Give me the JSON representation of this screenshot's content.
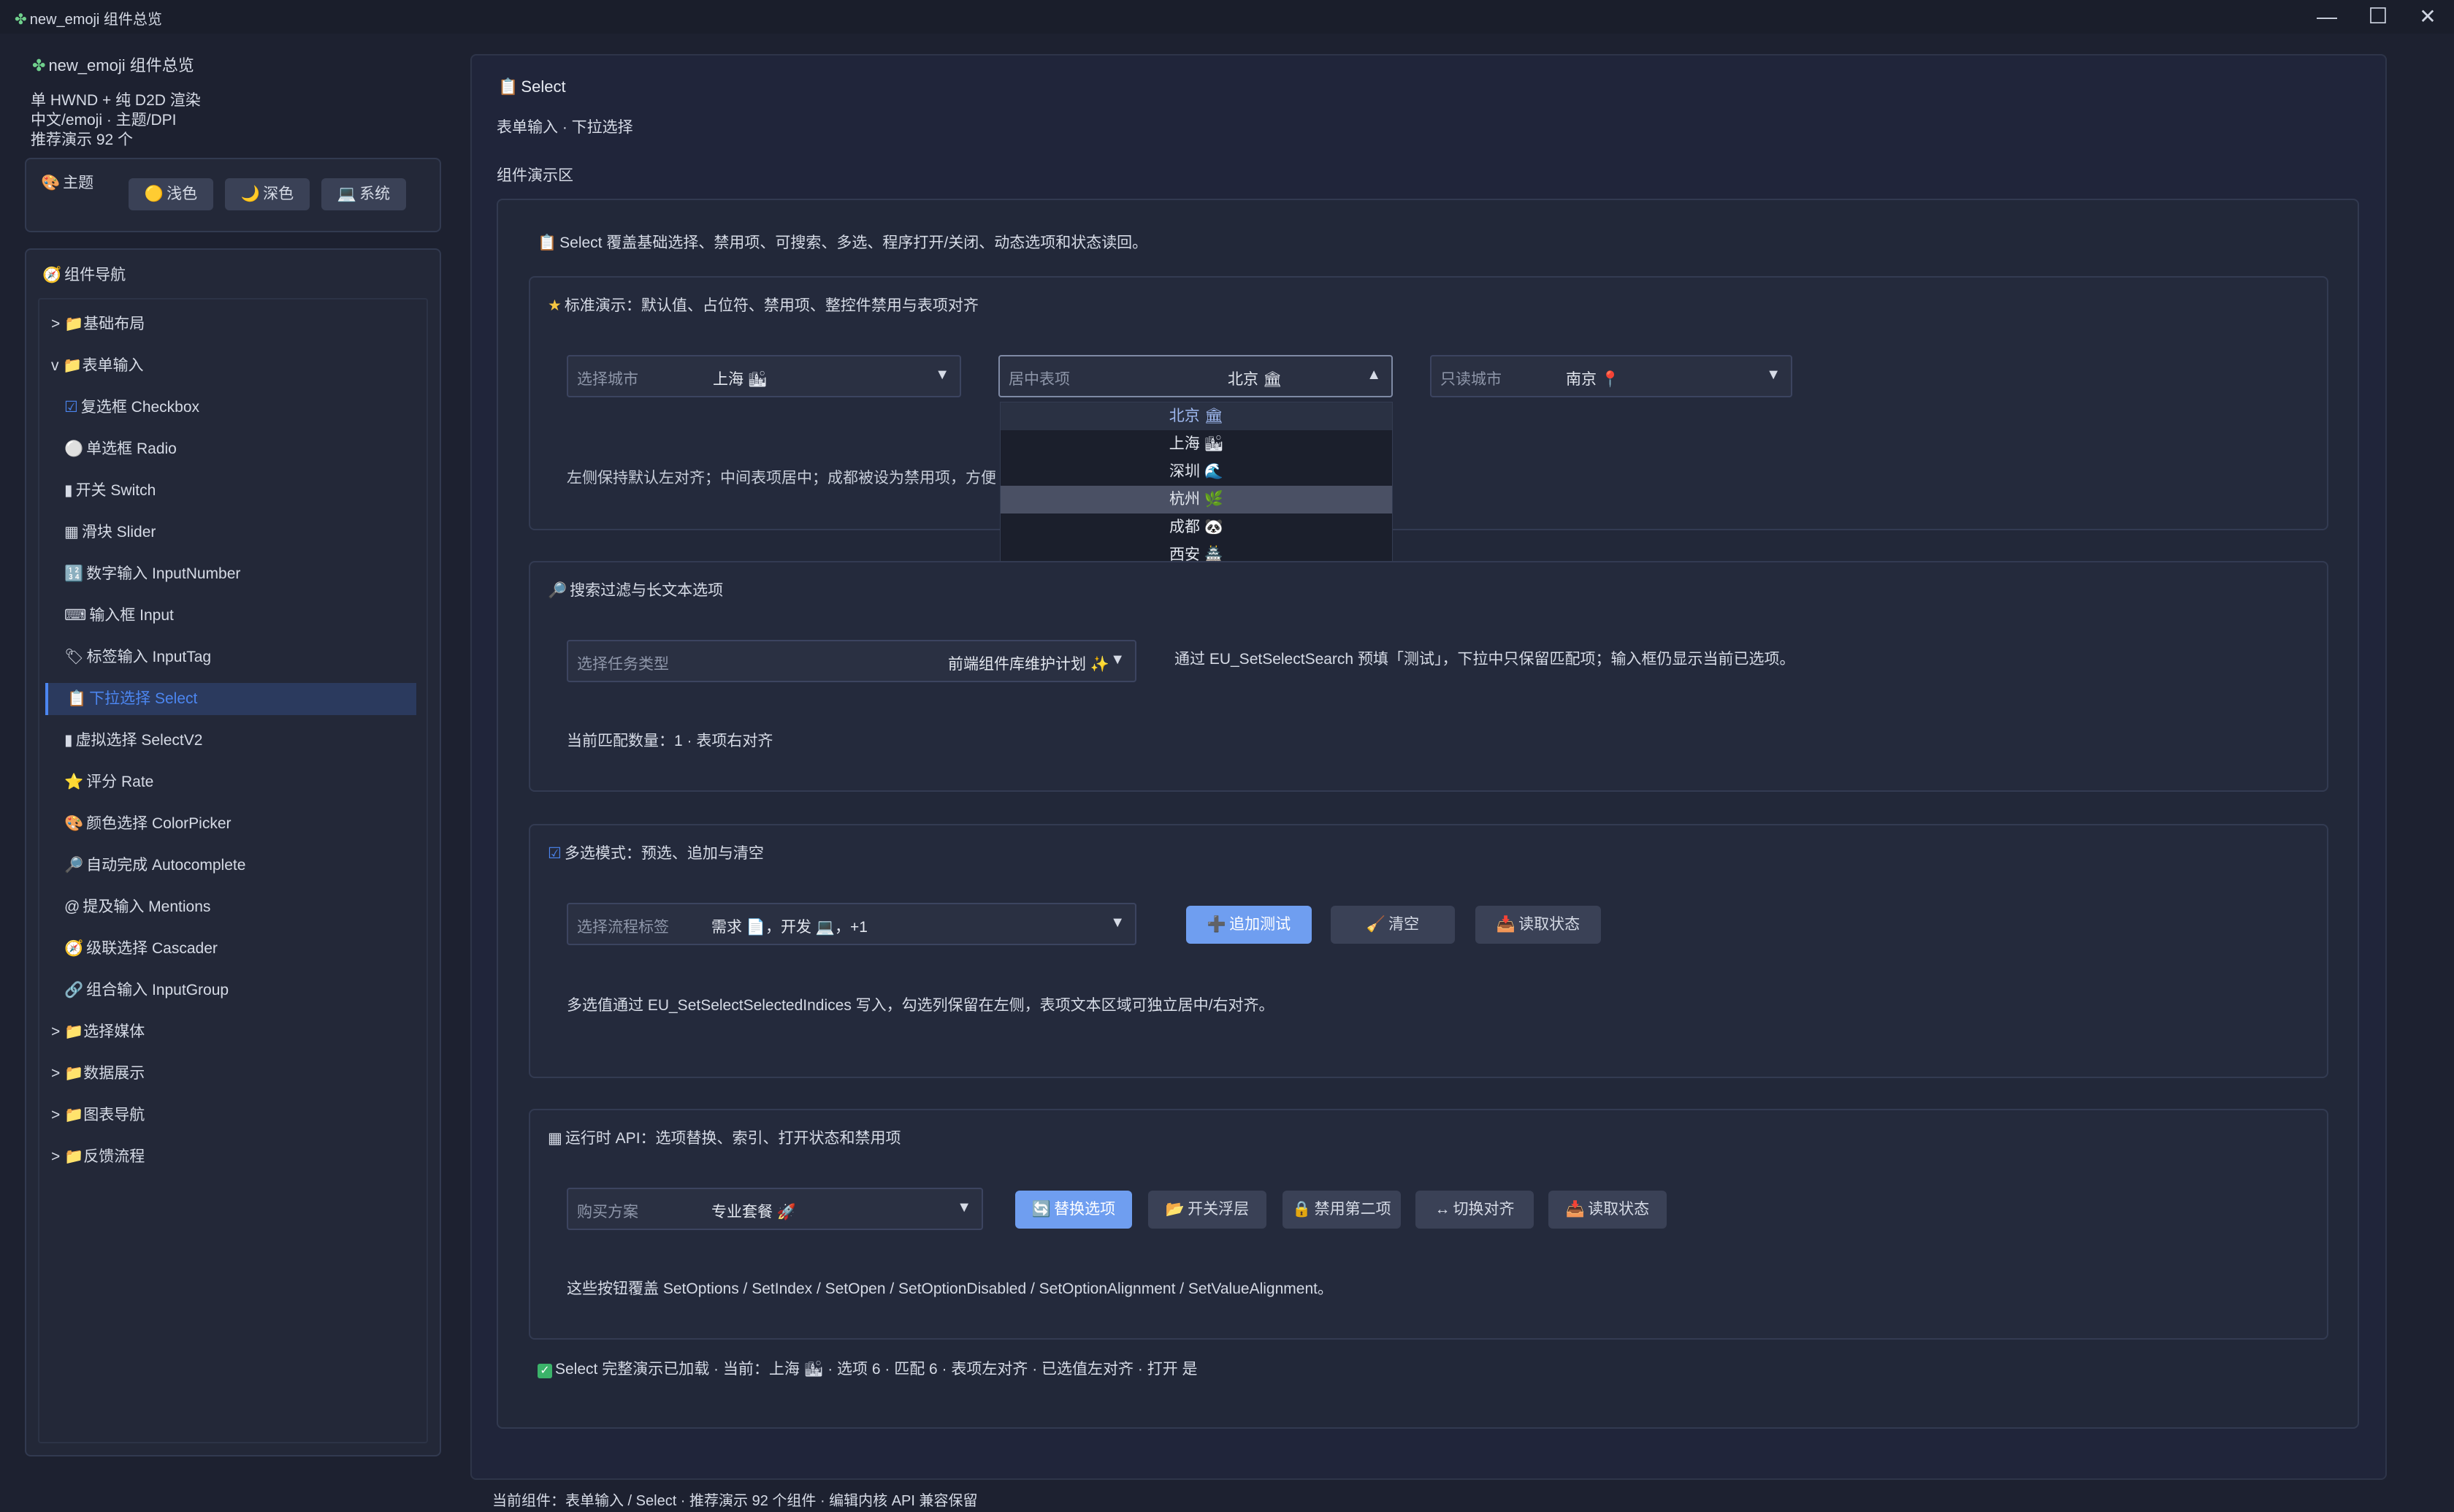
{
  "window": {
    "title": "new_emoji 组件总览",
    "controls": {
      "minimize": "—",
      "maximize": "☐",
      "close": "✕"
    }
  },
  "sidebar": {
    "app_title": "new_emoji 组件总览",
    "info_lines": [
      "单 HWND + 纯 D2D 渲染",
      "中文/emoji · 主题/DPI",
      "推荐演示 92 个"
    ],
    "theme": {
      "title": "主题",
      "buttons": [
        {
          "icon": "🟡",
          "label": "浅色"
        },
        {
          "icon": "🌙",
          "label": "深色"
        },
        {
          "icon": "💻",
          "label": "系统"
        }
      ]
    },
    "nav": {
      "title": "组件导航",
      "items": [
        {
          "prefix": ">",
          "icon": "📁",
          "label": "基础布局"
        },
        {
          "prefix": "v",
          "icon": "📁",
          "label": "表单输入"
        },
        {
          "icon": "☑",
          "label": "复选框 Checkbox"
        },
        {
          "icon": "⚪",
          "label": "单选框 Radio"
        },
        {
          "icon": "▮",
          "label": "开关 Switch"
        },
        {
          "icon": "▦",
          "label": "滑块 Slider"
        },
        {
          "icon": "🔢",
          "label": "数字输入 InputNumber"
        },
        {
          "icon": "⌨",
          "label": "输入框 Input"
        },
        {
          "icon": "🏷",
          "label": "标签输入 InputTag"
        },
        {
          "icon": "📋",
          "label": "下拉选择 Select",
          "selected": true
        },
        {
          "icon": "▮",
          "label": "虚拟选择 SelectV2"
        },
        {
          "icon": "⭐",
          "label": "评分 Rate"
        },
        {
          "icon": "🎨",
          "label": "颜色选择 ColorPicker"
        },
        {
          "icon": "🔎",
          "label": "自动完成 Autocomplete"
        },
        {
          "icon": "@",
          "label": "提及输入 Mentions"
        },
        {
          "icon": "🧭",
          "label": "级联选择 Cascader"
        },
        {
          "icon": "🔗",
          "label": "组合输入 InputGroup"
        },
        {
          "prefix": ">",
          "icon": "📁",
          "label": "选择媒体"
        },
        {
          "prefix": ">",
          "icon": "📁",
          "label": "数据展示"
        },
        {
          "prefix": ">",
          "icon": "📁",
          "label": "图表导航"
        },
        {
          "prefix": ">",
          "icon": "📁",
          "label": "反馈流程"
        }
      ]
    }
  },
  "main": {
    "title": "Select",
    "subtitle": "表单输入 · 下拉选择",
    "demo_area_label": "组件演示区",
    "intro": "Select 覆盖基础选择、禁用项、可搜索、多选、程序打开/关闭、动态选项和状态读回。",
    "standard": {
      "title": "标准演示：默认值、占位符、禁用项、整控件禁用与表项对齐",
      "select_left": {
        "label": "选择城市",
        "value": "上海 🏙"
      },
      "select_center": {
        "label": "居中表项",
        "value": "北京 🏛"
      },
      "select_right": {
        "label": "只读城市",
        "value": "南京 📍"
      },
      "dropdown_options": [
        "北京 🏛",
        "上海 🏙",
        "深圳 🌊",
        "杭州 🌿",
        "成都 🐼",
        "西安 🏯"
      ],
      "dropdown_hover_index": 3,
      "note": "左侧保持默认左对齐；中间表项居中；成都被设为禁用项，方便"
    },
    "search": {
      "title": "搜索过滤与长文本选项",
      "select": {
        "label": "选择任务类型",
        "value": "前端组件库维护计划 ✨"
      },
      "side_note": "通过 EU_SetSelectSearch 预填「测试」，下拉中只保留匹配项；输入框仍显示当前已选项。",
      "count_text": "当前匹配数量：1 · 表项右对齐"
    },
    "multi": {
      "title": "多选模式：预选、追加与清空",
      "select": {
        "label": "选择流程标签",
        "value": "需求 📄，开发 💻，+1"
      },
      "buttons": [
        {
          "icon": "➕",
          "label": "追加测试"
        },
        {
          "icon": "🧹",
          "label": "清空"
        },
        {
          "icon": "📥",
          "label": "读取状态"
        }
      ],
      "note": "多选值通过 EU_SetSelectSelectedIndices 写入，勾选列保留在左侧，表项文本区域可独立居中/右对齐。"
    },
    "runtime": {
      "title": "运行时 API：选项替换、索引、打开状态和禁用项",
      "select": {
        "label": "购买方案",
        "value": "专业套餐 🚀"
      },
      "buttons": [
        {
          "icon": "🔄",
          "label": "替换选项"
        },
        {
          "icon": "📂",
          "label": "开关浮层"
        },
        {
          "icon": "🔒",
          "label": "禁用第二项"
        },
        {
          "icon": "↔",
          "label": "切换对齐"
        },
        {
          "icon": "📥",
          "label": "读取状态"
        }
      ],
      "note": "这些按钮覆盖 SetOptions / SetIndex / SetOpen / SetOptionDisabled / SetOptionAlignment / SetValueAlignment。"
    },
    "status_line": "Select 完整演示已加载 · 当前：上海 🏙 · 选项 6 · 匹配 6 · 表项左对齐 · 已选值左对齐 · 打开 是"
  },
  "footer": "当前组件：表单输入 / Select · 推荐演示 92 个组件 · 编辑内核 API 兼容保留",
  "colors": {
    "accent": "#4c86f0",
    "primary_button": "#6f9ef0",
    "background": "#1d2130"
  }
}
